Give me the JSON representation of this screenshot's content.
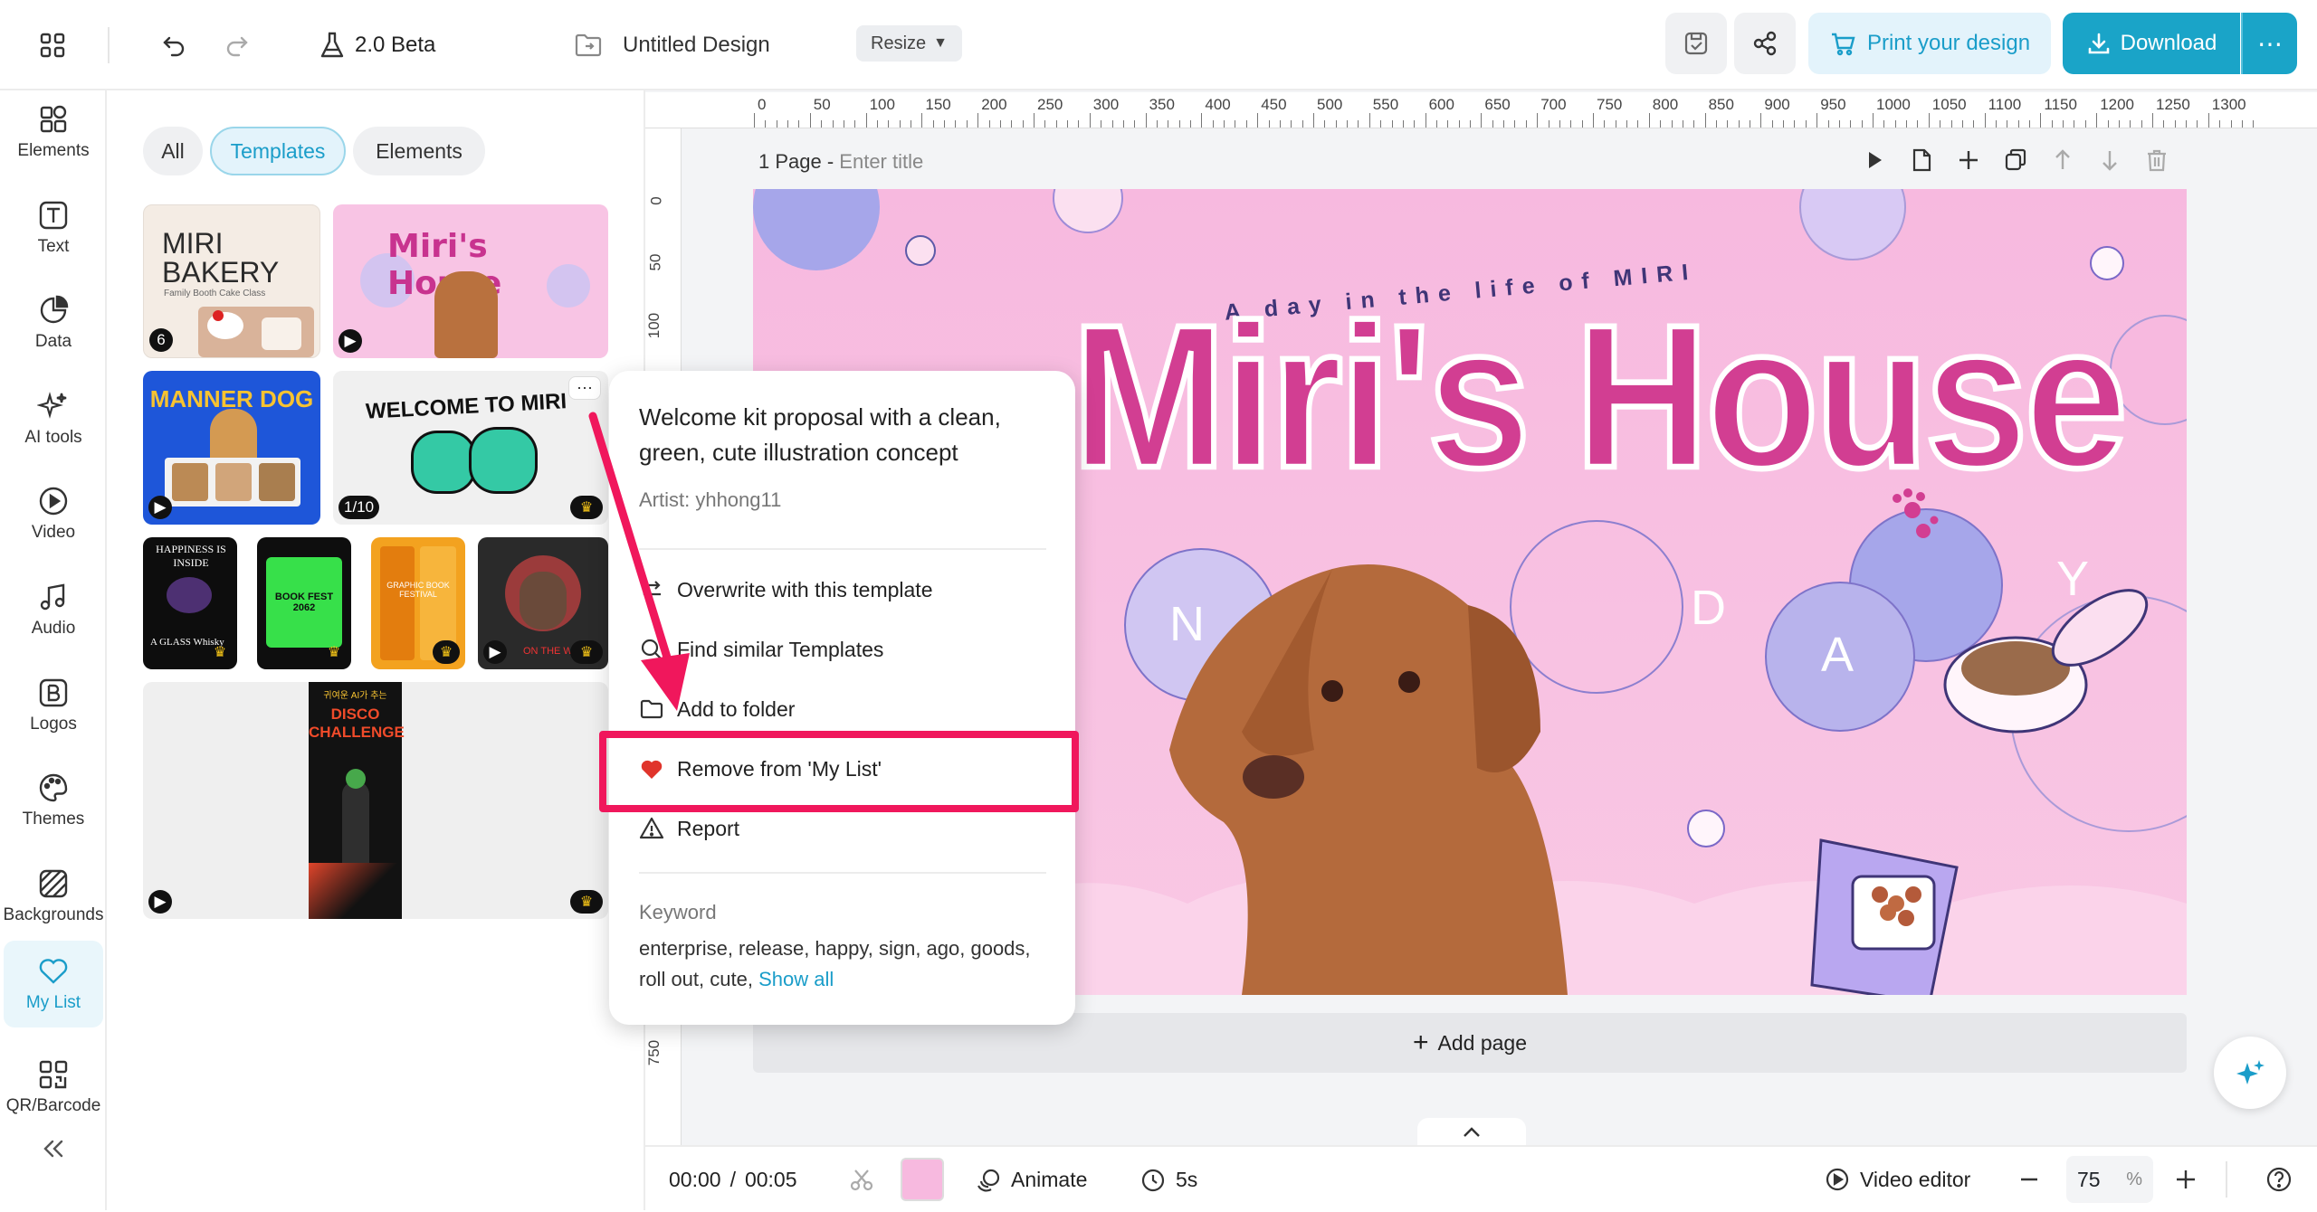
{
  "topbar": {
    "version_label": "2.0 Beta",
    "doc_title": "Untitled Design",
    "resize_label": "Resize",
    "print_label": "Print your design",
    "download_label": "Download"
  },
  "sidebar": {
    "items": [
      {
        "label": "Elements"
      },
      {
        "label": "Text"
      },
      {
        "label": "Data"
      },
      {
        "label": "AI tools"
      },
      {
        "label": "Video"
      },
      {
        "label": "Audio"
      },
      {
        "label": "Logos"
      },
      {
        "label": "Themes"
      },
      {
        "label": "Backgrounds"
      },
      {
        "label": "My List"
      },
      {
        "label": "QR/Barcode"
      }
    ]
  },
  "panel": {
    "filters": [
      "All",
      "Templates",
      "Elements"
    ],
    "active_filter": "Templates",
    "thumbs": {
      "t1_line1": "MIRI",
      "t1_line2": "BAKERY",
      "t1_sub": "Family Booth Cake Class",
      "t1_badge": "6",
      "t2_title": "Miri's House",
      "t3_title": "MANNER DOG",
      "t4_title": "WELCOME TO MIRI",
      "t4_badge": "1/10",
      "t5_text": "HAPPINESS IS INSIDE",
      "t5_sub": "A GLASS Whisky",
      "t6_text": "BOOK FEST 2062",
      "t7_text": "GRAPHIC BOOK FESTIVAL",
      "t8_text": "ON THE WAY",
      "t9_kr": "귀여운 AI가 추는",
      "t9_title": "DISCO CHALLENGE"
    }
  },
  "canvas": {
    "ruler_h": [
      "0",
      "50",
      "100",
      "150",
      "200",
      "250",
      "300",
      "350",
      "400",
      "450",
      "500",
      "550",
      "600",
      "650",
      "700",
      "750",
      "800",
      "850",
      "900",
      "950",
      "1000",
      "1050",
      "1100",
      "1150",
      "1200",
      "1250",
      "1300"
    ],
    "ruler_v": [
      "0",
      "50",
      "100",
      "750"
    ],
    "page_label": "1 Page -",
    "page_title_placeholder": "Enter title",
    "design": {
      "subtitle": "A day in the life of MIRI",
      "title": "Miri's House",
      "bubbles": [
        "N",
        "D",
        "A",
        "Y"
      ]
    },
    "add_page_label": "Add page"
  },
  "bottombar": {
    "time_current": "00:00",
    "time_sep": "/",
    "time_total": "00:05",
    "animate_label": "Animate",
    "duration_label": "5s",
    "video_editor_label": "Video editor",
    "zoom_value": "75",
    "zoom_unit": "%"
  },
  "popup": {
    "title": "Welcome kit proposal with a clean, green, cute illustration concept",
    "artist": "Artist: yhhong11",
    "actions": [
      {
        "label": "Overwrite with this template",
        "icon": "overwrite-icon"
      },
      {
        "label": "Find similar Templates",
        "icon": "search-icon"
      },
      {
        "label": "Add to folder",
        "icon": "folder-icon"
      },
      {
        "label": "Remove from 'My List'",
        "icon": "heart-icon"
      },
      {
        "label": "Report",
        "icon": "warning-icon"
      }
    ],
    "keyword_label": "Keyword",
    "keywords": "enterprise, release, happy, sign, ago, goods, roll out, cute,",
    "show_all": "Show all"
  },
  "colors": {
    "accent": "#1aa4c8",
    "highlight": "#f0175c",
    "heart": "#e0342b"
  }
}
